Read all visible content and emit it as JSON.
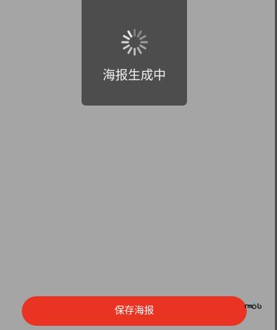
{
  "loading_toast": {
    "text": "海报生成中",
    "icon": "spinner-icon"
  },
  "save_button": {
    "label": "保存海报"
  },
  "colors": {
    "overlay": "#a5a5a5",
    "toast_background": "#4d4d4d",
    "primary": "#e93323"
  }
}
